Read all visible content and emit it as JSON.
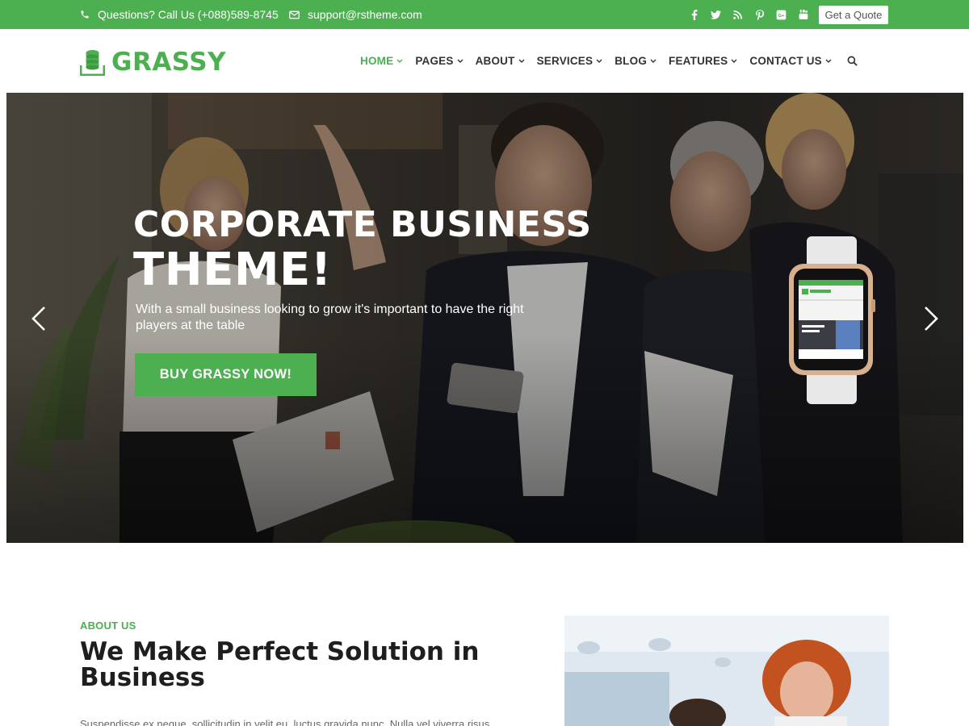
{
  "topbar": {
    "phone_text": "Questions? Call Us (+088)589-8745",
    "email_text": "support@rstheme.com",
    "socials": [
      "facebook-icon",
      "twitter-icon",
      "rss-icon",
      "pinterest-icon",
      "google-plus-icon",
      "youtube-icon"
    ],
    "google_plus_glyph": "G+",
    "quote_label": "Get a Quote",
    "background": "#4caf50"
  },
  "header": {
    "logo_text": "GRASSY",
    "nav": [
      {
        "label": "HOME",
        "active": true
      },
      {
        "label": "PAGES",
        "active": false
      },
      {
        "label": "ABOUT",
        "active": false
      },
      {
        "label": "SERVICES",
        "active": false
      },
      {
        "label": "BLOG",
        "active": false
      },
      {
        "label": "FEATURES",
        "active": false
      },
      {
        "label": "CONTACT US",
        "active": false
      }
    ]
  },
  "hero": {
    "title_line1": "CORPORATE BUSINESS",
    "title_line2": "THEME!",
    "subtitle": "With a small business looking to grow it's important to have the right players at the table",
    "cta_label": "BUY GRASSY NOW!"
  },
  "about": {
    "kicker": "ABOUT US",
    "title": "We Make Perfect Solution in Business",
    "text": "Suspendisse ex neque, sollicitudin in velit eu, luctus gravida nunc. Nulla vel viverra risus"
  },
  "colors": {
    "accent": "#4caf50",
    "dark_text": "#1e1e1e"
  }
}
